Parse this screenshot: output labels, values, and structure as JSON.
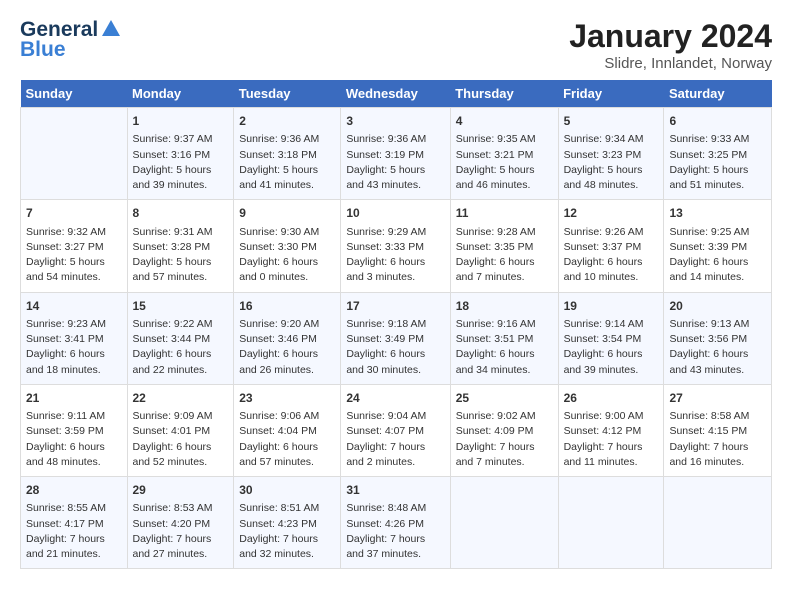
{
  "header": {
    "logo_general": "General",
    "logo_blue": "Blue",
    "title": "January 2024",
    "subtitle": "Slidre, Innlandet, Norway"
  },
  "columns": [
    "Sunday",
    "Monday",
    "Tuesday",
    "Wednesday",
    "Thursday",
    "Friday",
    "Saturday"
  ],
  "weeks": [
    [
      {
        "day": "",
        "sunrise": "",
        "sunset": "",
        "daylight": ""
      },
      {
        "day": "1",
        "sunrise": "Sunrise: 9:37 AM",
        "sunset": "Sunset: 3:16 PM",
        "daylight": "Daylight: 5 hours and 39 minutes."
      },
      {
        "day": "2",
        "sunrise": "Sunrise: 9:36 AM",
        "sunset": "Sunset: 3:18 PM",
        "daylight": "Daylight: 5 hours and 41 minutes."
      },
      {
        "day": "3",
        "sunrise": "Sunrise: 9:36 AM",
        "sunset": "Sunset: 3:19 PM",
        "daylight": "Daylight: 5 hours and 43 minutes."
      },
      {
        "day": "4",
        "sunrise": "Sunrise: 9:35 AM",
        "sunset": "Sunset: 3:21 PM",
        "daylight": "Daylight: 5 hours and 46 minutes."
      },
      {
        "day": "5",
        "sunrise": "Sunrise: 9:34 AM",
        "sunset": "Sunset: 3:23 PM",
        "daylight": "Daylight: 5 hours and 48 minutes."
      },
      {
        "day": "6",
        "sunrise": "Sunrise: 9:33 AM",
        "sunset": "Sunset: 3:25 PM",
        "daylight": "Daylight: 5 hours and 51 minutes."
      }
    ],
    [
      {
        "day": "7",
        "sunrise": "Sunrise: 9:32 AM",
        "sunset": "Sunset: 3:27 PM",
        "daylight": "Daylight: 5 hours and 54 minutes."
      },
      {
        "day": "8",
        "sunrise": "Sunrise: 9:31 AM",
        "sunset": "Sunset: 3:28 PM",
        "daylight": "Daylight: 5 hours and 57 minutes."
      },
      {
        "day": "9",
        "sunrise": "Sunrise: 9:30 AM",
        "sunset": "Sunset: 3:30 PM",
        "daylight": "Daylight: 6 hours and 0 minutes."
      },
      {
        "day": "10",
        "sunrise": "Sunrise: 9:29 AM",
        "sunset": "Sunset: 3:33 PM",
        "daylight": "Daylight: 6 hours and 3 minutes."
      },
      {
        "day": "11",
        "sunrise": "Sunrise: 9:28 AM",
        "sunset": "Sunset: 3:35 PM",
        "daylight": "Daylight: 6 hours and 7 minutes."
      },
      {
        "day": "12",
        "sunrise": "Sunrise: 9:26 AM",
        "sunset": "Sunset: 3:37 PM",
        "daylight": "Daylight: 6 hours and 10 minutes."
      },
      {
        "day": "13",
        "sunrise": "Sunrise: 9:25 AM",
        "sunset": "Sunset: 3:39 PM",
        "daylight": "Daylight: 6 hours and 14 minutes."
      }
    ],
    [
      {
        "day": "14",
        "sunrise": "Sunrise: 9:23 AM",
        "sunset": "Sunset: 3:41 PM",
        "daylight": "Daylight: 6 hours and 18 minutes."
      },
      {
        "day": "15",
        "sunrise": "Sunrise: 9:22 AM",
        "sunset": "Sunset: 3:44 PM",
        "daylight": "Daylight: 6 hours and 22 minutes."
      },
      {
        "day": "16",
        "sunrise": "Sunrise: 9:20 AM",
        "sunset": "Sunset: 3:46 PM",
        "daylight": "Daylight: 6 hours and 26 minutes."
      },
      {
        "day": "17",
        "sunrise": "Sunrise: 9:18 AM",
        "sunset": "Sunset: 3:49 PM",
        "daylight": "Daylight: 6 hours and 30 minutes."
      },
      {
        "day": "18",
        "sunrise": "Sunrise: 9:16 AM",
        "sunset": "Sunset: 3:51 PM",
        "daylight": "Daylight: 6 hours and 34 minutes."
      },
      {
        "day": "19",
        "sunrise": "Sunrise: 9:14 AM",
        "sunset": "Sunset: 3:54 PM",
        "daylight": "Daylight: 6 hours and 39 minutes."
      },
      {
        "day": "20",
        "sunrise": "Sunrise: 9:13 AM",
        "sunset": "Sunset: 3:56 PM",
        "daylight": "Daylight: 6 hours and 43 minutes."
      }
    ],
    [
      {
        "day": "21",
        "sunrise": "Sunrise: 9:11 AM",
        "sunset": "Sunset: 3:59 PM",
        "daylight": "Daylight: 6 hours and 48 minutes."
      },
      {
        "day": "22",
        "sunrise": "Sunrise: 9:09 AM",
        "sunset": "Sunset: 4:01 PM",
        "daylight": "Daylight: 6 hours and 52 minutes."
      },
      {
        "day": "23",
        "sunrise": "Sunrise: 9:06 AM",
        "sunset": "Sunset: 4:04 PM",
        "daylight": "Daylight: 6 hours and 57 minutes."
      },
      {
        "day": "24",
        "sunrise": "Sunrise: 9:04 AM",
        "sunset": "Sunset: 4:07 PM",
        "daylight": "Daylight: 7 hours and 2 minutes."
      },
      {
        "day": "25",
        "sunrise": "Sunrise: 9:02 AM",
        "sunset": "Sunset: 4:09 PM",
        "daylight": "Daylight: 7 hours and 7 minutes."
      },
      {
        "day": "26",
        "sunrise": "Sunrise: 9:00 AM",
        "sunset": "Sunset: 4:12 PM",
        "daylight": "Daylight: 7 hours and 11 minutes."
      },
      {
        "day": "27",
        "sunrise": "Sunrise: 8:58 AM",
        "sunset": "Sunset: 4:15 PM",
        "daylight": "Daylight: 7 hours and 16 minutes."
      }
    ],
    [
      {
        "day": "28",
        "sunrise": "Sunrise: 8:55 AM",
        "sunset": "Sunset: 4:17 PM",
        "daylight": "Daylight: 7 hours and 21 minutes."
      },
      {
        "day": "29",
        "sunrise": "Sunrise: 8:53 AM",
        "sunset": "Sunset: 4:20 PM",
        "daylight": "Daylight: 7 hours and 27 minutes."
      },
      {
        "day": "30",
        "sunrise": "Sunrise: 8:51 AM",
        "sunset": "Sunset: 4:23 PM",
        "daylight": "Daylight: 7 hours and 32 minutes."
      },
      {
        "day": "31",
        "sunrise": "Sunrise: 8:48 AM",
        "sunset": "Sunset: 4:26 PM",
        "daylight": "Daylight: 7 hours and 37 minutes."
      },
      {
        "day": "",
        "sunrise": "",
        "sunset": "",
        "daylight": ""
      },
      {
        "day": "",
        "sunrise": "",
        "sunset": "",
        "daylight": ""
      },
      {
        "day": "",
        "sunrise": "",
        "sunset": "",
        "daylight": ""
      }
    ]
  ]
}
